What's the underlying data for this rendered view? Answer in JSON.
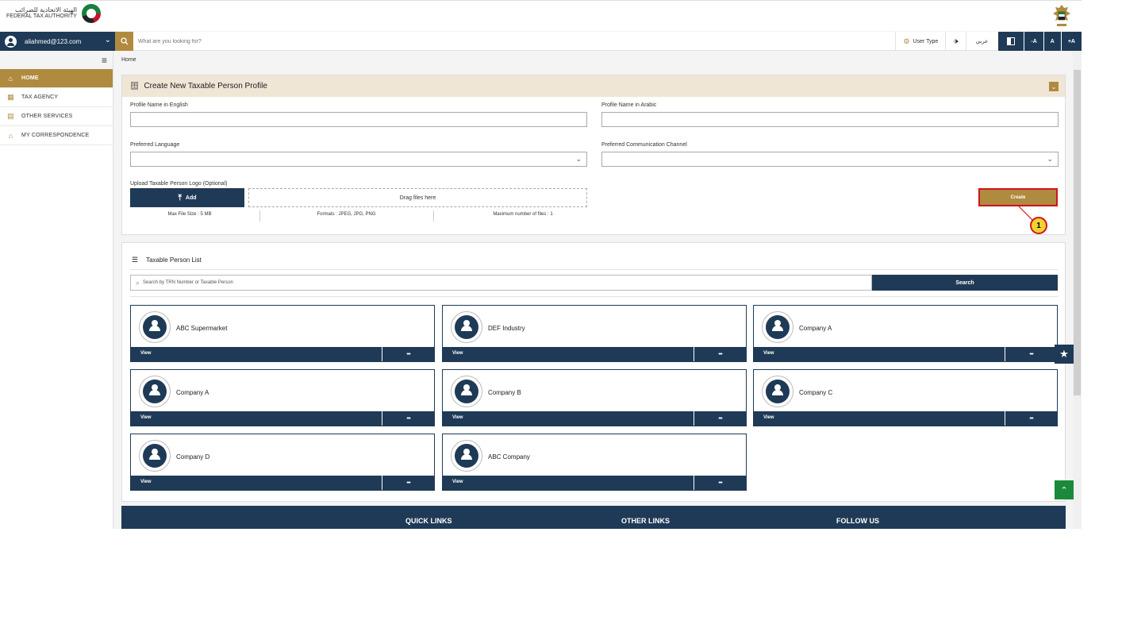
{
  "header": {
    "logo_arabic": "الهيئة الاتحادية للضرائب",
    "logo_english": "FEDERAL TAX AUTHORITY"
  },
  "navbar": {
    "user_email": "aliahmed@123.com",
    "search_placeholder": "What are you looking for?",
    "user_type_label": "User Type",
    "language_label": "عربي",
    "font_decrease": "-A",
    "font_normal": "A",
    "font_increase": "+A"
  },
  "sidebar": {
    "items": [
      {
        "label": "HOME",
        "icon": "home-icon",
        "active": true
      },
      {
        "label": "TAX AGENCY",
        "icon": "building-icon",
        "active": false
      },
      {
        "label": "OTHER SERVICES",
        "icon": "document-icon",
        "active": false
      },
      {
        "label": "MY CORRESPONDENCE",
        "icon": "bank-icon",
        "active": false
      }
    ]
  },
  "breadcrumb": "Home",
  "create_panel": {
    "title": "Create New Taxable Person Profile",
    "name_en_label": "Profile Name in English",
    "name_ar_label": "Profile Name in Arabic",
    "language_label": "Preferred Language",
    "channel_label": "Preferred Communication Channel",
    "upload_label": "Upload Taxable Person Logo (Optional)",
    "add_label": "Add",
    "drag_label": "Drag files here",
    "max_size": "Max File Size : 5 MB",
    "formats": "Formats : JPEG, JPG, PNG",
    "max_files": "Maximum number of files : 1",
    "create_label": "Create",
    "callout_number": "1"
  },
  "list_panel": {
    "title": "Taxable Person List",
    "search_placeholder": "Search by TRN Number or Taxable Person",
    "search_label": "Search",
    "view_label": "View",
    "more_label": "•••",
    "cards": [
      "ABC Supermarket",
      "DEF Industry",
      "Company A",
      "Company A",
      "Company B",
      "Company C",
      "Company D",
      "ABC Company"
    ]
  },
  "footer": {
    "quick_links": "QUICK LINKS",
    "other_links": "OTHER LINKS",
    "follow_us": "FOLLOW US"
  },
  "colors": {
    "navy": "#1f3a56",
    "gold": "#b08a3e",
    "highlight_red": "#d0141e",
    "callout_yellow": "#f2d233"
  }
}
